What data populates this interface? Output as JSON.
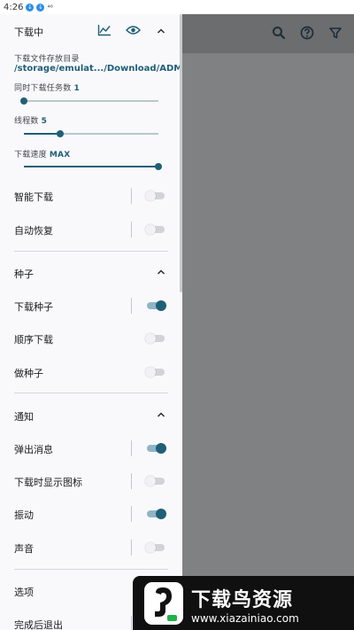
{
  "status_bar": {
    "time": "4:26",
    "notif1": "↓",
    "notif2": "↓",
    "signal": "⁴⁶"
  },
  "downloading": {
    "title": "下载中",
    "folder_label": "下载文件存放目录",
    "folder_path": "/storage/emulat.../Download/ADM",
    "tasks_label": "同时下载任务数",
    "tasks_value": "1",
    "tasks_level": 0.0,
    "threads_label": "线程数",
    "threads_value": "5",
    "threads_level": 0.27,
    "speed_label": "下载速度",
    "speed_value": "MAX",
    "speed_level": 1.0,
    "smart_download": "智能下载",
    "auto_resume": "自动恢复"
  },
  "torrent": {
    "title": "种子",
    "download_torrent": "下载种子",
    "sequential": "顺序下载",
    "seeding": "做种子"
  },
  "notify": {
    "title": "通知",
    "popup": "弹出消息",
    "show_icon": "下载时显示图标",
    "vibrate": "振动",
    "sound": "声音"
  },
  "options": {
    "title": "选项",
    "exit_after": "完成后退出"
  },
  "toggles": {
    "smart_download": false,
    "auto_resume": false,
    "download_torrent": true,
    "sequential": false,
    "seeding": false,
    "popup": true,
    "show_icon": false,
    "vibrate": true,
    "sound": false
  },
  "colors": {
    "accent": "#1f5f78",
    "accent_track": "#8fb4c6",
    "drawer_bg": "#f9f9fc",
    "scrim": "#808183"
  },
  "icons": {
    "stats": "chart-line-icon",
    "visibility": "eye-icon",
    "collapse": "chevron-up-icon",
    "search": "search-icon",
    "help": "help-circle-icon",
    "filter": "filter-icon"
  },
  "watermark": {
    "title": "下载鸟资源",
    "url": "www.xiazainiao.com"
  }
}
